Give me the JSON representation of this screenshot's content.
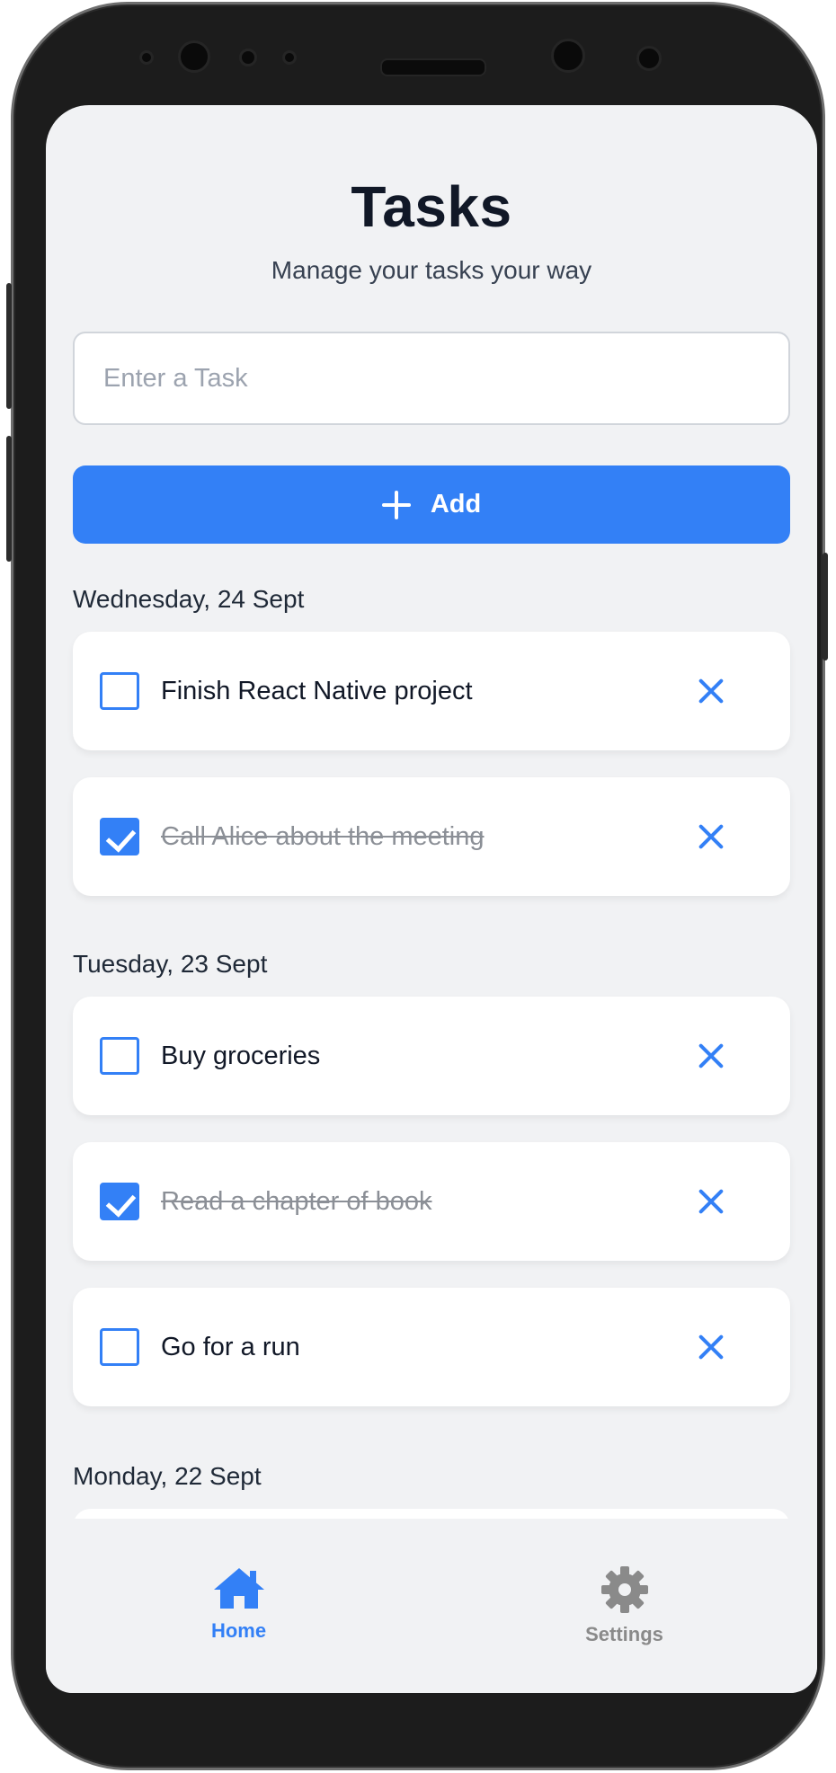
{
  "app": {
    "title": "Tasks",
    "subtitle": "Manage your tasks your way"
  },
  "task_input": {
    "value": "",
    "placeholder": "Enter a Task"
  },
  "add_button": {
    "label": "Add",
    "icon": "plus-icon"
  },
  "sections": [
    {
      "date": "Wednesday, 24 Sept",
      "tasks": [
        {
          "text": "Finish React Native project",
          "completed": false
        },
        {
          "text": "Call Alice about the meeting",
          "completed": true
        }
      ]
    },
    {
      "date": "Tuesday, 23 Sept",
      "tasks": [
        {
          "text": "Buy groceries",
          "completed": false
        },
        {
          "text": "Read a chapter of book",
          "completed": true
        },
        {
          "text": "Go for a run",
          "completed": false
        }
      ]
    },
    {
      "date": "Monday, 22 Sept",
      "tasks": []
    }
  ],
  "tabs": [
    {
      "label": "Home",
      "icon": "home-icon",
      "active": true
    },
    {
      "label": "Settings",
      "icon": "gear-icon",
      "active": false
    }
  ],
  "colors": {
    "accent": "#3380f6",
    "background": "#f1f2f4",
    "card": "#ffffff",
    "text": "#111827",
    "completed_text": "#8b8f96",
    "inactive_tab": "#8a8a8a"
  }
}
